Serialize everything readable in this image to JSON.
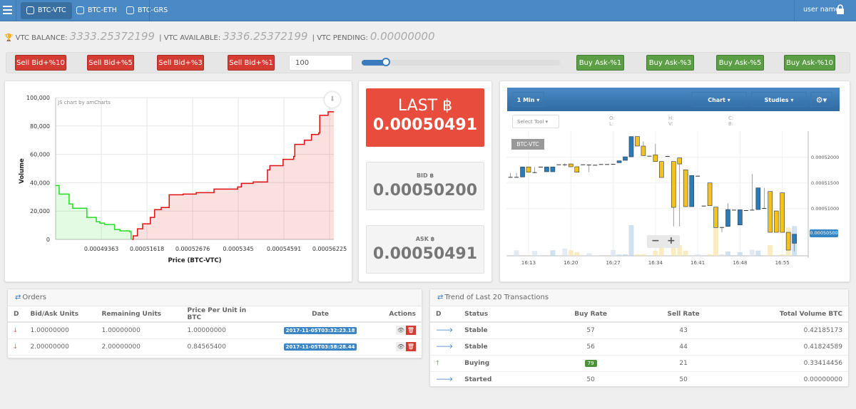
{
  "nav": {
    "tabs": [
      {
        "label": "BTC-VTC",
        "active": true
      },
      {
        "label": "BTC-ETH"
      },
      {
        "label": "BTC-GRS"
      }
    ],
    "user": "user name",
    "icons": {
      "menu": "hamburger-icon",
      "tab": "coins-icon",
      "user": "lock-icon"
    }
  },
  "balance": {
    "balance_label": "VTC BALANCE:",
    "balance": "3333.25372199",
    "available_label": "| VTC AVAILABLE:",
    "available": "3336.25372199",
    "pending_label": "| VTC PENDING:",
    "pending": "0.00000000"
  },
  "toolbar": {
    "sell": [
      "Sell Bid+%10",
      "Sell Bid+%5",
      "Sell Bid+%3",
      "Sell Bid+%1"
    ],
    "buy": [
      "Buy Ask-%1",
      "Buy Ask-%3",
      "Buy Ask-%5",
      "Buy Ask-%10"
    ],
    "quantity": "100",
    "slider_percent": 10,
    "colors": {
      "sell": "#d43b32",
      "buy": "#5b9e45"
    }
  },
  "prices": {
    "last_label": "LAST ฿",
    "last": "0.00050491",
    "bid_label": "BID ฿",
    "bid": "0.00050200",
    "ask_label": "ASK ฿",
    "ask": "0.00050491"
  },
  "chart_data": [
    {
      "type": "area",
      "title": "",
      "credit": "JS chart by amCharts",
      "xlabel": "Price (BTC-VTC)",
      "ylabel": "Volume",
      "ylim": [
        0,
        100000
      ],
      "yticks": [
        "0",
        "20,000",
        "40,000",
        "60,000",
        "80,000",
        "100,000"
      ],
      "xticks": [
        "0.00049363",
        "0.00051618",
        "0.00052676",
        "0.0005345",
        "0.00054591",
        "0.00056225"
      ],
      "grid": true,
      "series": [
        {
          "color": "#22dd22",
          "points": [
            [
              0.00047094,
              38000
            ],
            [
              0.00047283,
              32000
            ],
            [
              0.00047774,
              25000
            ],
            [
              0.0004795,
              22000
            ],
            [
              0.00048651,
              15500
            ],
            [
              0.00049118,
              12500
            ],
            [
              0.00049293,
              11500
            ],
            [
              0.00049528,
              10500
            ],
            [
              0.00050019,
              7000
            ],
            [
              0.00050285,
              6000
            ],
            [
              0.00050755,
              5500
            ],
            [
              0.00050836,
              0
            ]
          ]
        },
        {
          "color": "#e01010",
          "points": [
            [
              0.00050887,
              0
            ],
            [
              0.00050937,
              2500
            ],
            [
              0.00051147,
              7500
            ],
            [
              0.00051405,
              11000
            ],
            [
              0.00051696,
              15500
            ],
            [
              0.00051794,
              21000
            ],
            [
              0.00051948,
              22500
            ],
            [
              0.00052134,
              31500
            ],
            [
              0.00052455,
              32000
            ],
            [
              0.00052737,
              33000
            ],
            [
              0.00053039,
              35500
            ],
            [
              0.0005344,
              37000
            ],
            [
              0.00053527,
              39500
            ],
            [
              0.00053824,
              40500
            ],
            [
              0.0005418,
              49000
            ],
            [
              0.0005424,
              52000
            ],
            [
              0.0005457,
              56500
            ],
            [
              0.0005494,
              58500
            ],
            [
              0.00054981,
              67000
            ],
            [
              0.00055323,
              70000
            ],
            [
              0.00055578,
              74000
            ],
            [
              0.00055833,
              75000
            ],
            [
              0.00055874,
              87500
            ],
            [
              0.00056172,
              90000
            ],
            [
              0.00056384,
              90000
            ]
          ]
        }
      ]
    },
    {
      "type": "candlestick",
      "symbol": "BTC-VTC",
      "interval": "1 Min",
      "controls": {
        "chart": "Chart",
        "studies": "Studies",
        "select_tool": "Select Tool",
        "zoom_out": "−",
        "zoom_in": "+"
      },
      "ohlc_labels": [
        "O:",
        "L:",
        "H:",
        "V:",
        "C:",
        "B:"
      ],
      "xticks": [
        "16:13",
        "16:20",
        "16:27",
        "16:34",
        "16:41",
        "16:48",
        "16:55"
      ],
      "yticks": [
        "0.00052000",
        "0.00051500",
        "0.00051000"
      ],
      "last_price": "0.00050500",
      "colors": {
        "up": "#2b7bb9",
        "down": "#f4c21b"
      },
      "candles_columns": [
        "time",
        "open",
        "high",
        "low",
        "close",
        "volume_fraction"
      ],
      "candles": [
        [
          "16:10",
          0.00051616,
          0.00051694,
          0.00051616,
          0.00051616,
          0
        ],
        [
          "16:11",
          0.00051616,
          0.00051694,
          0.00051616,
          0.00051616,
          0.18
        ],
        [
          "16:12",
          0.00051616,
          0.0005181,
          0.00051616,
          0.0005181,
          0
        ],
        [
          "16:13",
          0.0005181,
          0.0005181,
          0.00051708,
          0.00051708,
          0
        ],
        [
          "16:14",
          0.00051708,
          0.0005181,
          0.00051694,
          0.00051708,
          0.16
        ],
        [
          "16:15",
          0.00051815,
          0.00051815,
          0.00051815,
          0.00051815,
          0
        ],
        [
          "16:16",
          0.00051718,
          0.0005181,
          0.00051718,
          0.0005181,
          0
        ],
        [
          "16:17",
          0.00051718,
          0.0005181,
          0.00051718,
          0.0005181,
          0.18
        ],
        [
          "16:18",
          0.00051861,
          0.00051861,
          0.00051861,
          0.00051861,
          0
        ],
        [
          "16:19",
          0.00051861,
          0.0005188,
          0.00051824,
          0.00051861,
          0.24
        ],
        [
          "16:20",
          0.0005187,
          0.0005187,
          0.00051815,
          0.00051815,
          0.18
        ],
        [
          "16:21",
          0.00051815,
          0.00051815,
          0.00051708,
          0.00051708,
          0.12
        ],
        [
          "16:22",
          0.00051861,
          0.00051861,
          0.00051861,
          0.00051861,
          0
        ],
        [
          "16:23",
          0.00051856,
          0.00051856,
          0.00051708,
          0.00051856,
          0.08
        ],
        [
          "16:24",
          0.00051852,
          0.00051852,
          0.00051852,
          0.00051852,
          0.02
        ],
        [
          "16:25",
          0.00051866,
          0.00051866,
          0.00051866,
          0.00051866,
          0
        ],
        [
          "16:26",
          0.00051866,
          0.00051866,
          0.00051866,
          0.00051866,
          0
        ],
        [
          "16:27",
          0.0005187,
          0.0005187,
          0.0005187,
          0.0005187,
          0.19
        ],
        [
          "16:28",
          0.00051894,
          0.00051931,
          0.00051894,
          0.00051931,
          0.04
        ],
        [
          "16:29",
          0.0005194,
          0.00052009,
          0.0005194,
          0.00052009,
          0.05
        ],
        [
          "16:30",
          0.00052009,
          0.00052403,
          0.00052009,
          0.00052403,
          1.0
        ],
        [
          "16:31",
          0.00052403,
          0.00052403,
          0.00052218,
          0.00052218,
          0.05
        ],
        [
          "16:32",
          0.00052218,
          0.0005231,
          0.00052032,
          0.00052032,
          0.05
        ],
        [
          "16:33",
          0.00052028,
          0.00052028,
          0.00052028,
          0.00052028,
          0
        ],
        [
          "16:34",
          0.00052046,
          0.00052264,
          0.00051917,
          0.00051917,
          0.17
        ],
        [
          "16:35",
          0.00051917,
          0.00051917,
          0.00051606,
          0.00051606,
          0.35
        ],
        [
          "16:36",
          0.00052023,
          0.00052023,
          0.00052023,
          0.00052023,
          0
        ],
        [
          "16:37",
          0.00051917,
          0.00051917,
          0.00050653,
          0.00051023,
          0.62
        ],
        [
          "16:38",
          0.00051986,
          0.00051986,
          0.00050653,
          0.0005187,
          0.35
        ],
        [
          "16:39",
          0.00051755,
          0.00051755,
          0.00051037,
          0.00051037,
          0.17
        ],
        [
          "16:40",
          0.00051037,
          0.00051644,
          0.00051037,
          0.00051644,
          0
        ],
        [
          "16:41",
          0.00051639,
          0.00051639,
          0.00051639,
          0.00051639,
          0.05
        ],
        [
          "16:42",
          0.00051056,
          0.00051056,
          0.00051056,
          0.00051056,
          0
        ],
        [
          "16:43",
          0.000515,
          0.000515,
          0.00051056,
          0.00051056,
          0.05
        ],
        [
          "16:44",
          0.00051028,
          0.00051028,
          0.0005063,
          0.0005063,
          0.92
        ],
        [
          "16:45",
          0.00050639,
          0.00050639,
          0.00050537,
          0.00050639,
          0.05
        ],
        [
          "16:46",
          0.00050653,
          0.00051102,
          0.00050653,
          0.00050981,
          0.14
        ],
        [
          "16:47",
          0.00050977,
          0.00050977,
          0.00050977,
          0.00050977,
          0
        ],
        [
          "16:48",
          0.00050681,
          0.00050977,
          0.00050681,
          0.00050977,
          0.12
        ],
        [
          "16:49",
          0.00050968,
          0.00050968,
          0.00050968,
          0.00050968,
          0
        ],
        [
          "16:50",
          0.00050977,
          0.00051671,
          0.00050977,
          0.00050977,
          0.2
        ],
        [
          "16:51",
          0.00050981,
          0.00051403,
          0.00050981,
          0.00051403,
          0.17
        ],
        [
          "16:52",
          0.00051009,
          0.00051403,
          0.00051009,
          0.00051009,
          0
        ],
        [
          "16:53",
          0.00051333,
          0.00051333,
          0.00050537,
          0.00050537,
          0.35
        ],
        [
          "16:54",
          0.00050954,
          0.00050954,
          0.00050537,
          0.00050537,
          0
        ],
        [
          "16:55",
          0.00051306,
          0.00051306,
          0.00050537,
          0.00050537,
          0.05
        ],
        [
          "16:56",
          0.00050537,
          0.00050537,
          0.0005019,
          0.0005019,
          0.92
        ],
        [
          "16:57",
          0.00050324,
          0.000505,
          0.00050167,
          0.000505,
          0.97
        ]
      ]
    }
  ],
  "orders": {
    "title": "Orders",
    "columns": [
      "D",
      "Bid/Ask Units",
      "Remaining Units",
      "Price Per Unit in BTC",
      "Date",
      "Actions"
    ],
    "rows": [
      {
        "units": "1.00000000",
        "remaining": "1.00000000",
        "price": "1.00000000",
        "date": "2017-11-05T03:32:23.18"
      },
      {
        "units": "2.00000000",
        "remaining": "2.00000000",
        "price": "0.84565400",
        "date": "2017-11-05T03:58:28.44"
      }
    ]
  },
  "trend": {
    "title": "Trend of Last 20 Transactions",
    "columns": [
      "D",
      "Status",
      "Buy Rate",
      "Sell Rate",
      "Total Volume BTC"
    ],
    "rows": [
      {
        "dir": "right",
        "status": "Stable",
        "buy": "57",
        "sell": "43",
        "volume": "0.42185173"
      },
      {
        "dir": "right",
        "status": "Stable",
        "buy": "56",
        "sell": "44",
        "volume": "0.41824589"
      },
      {
        "dir": "up",
        "status": "Buying",
        "buy": "79",
        "sell": "21",
        "volume": "0.33414456",
        "highlight": true
      },
      {
        "dir": "right",
        "status": "Started",
        "buy": "50",
        "sell": "50",
        "volume": "0.00000000"
      }
    ]
  }
}
